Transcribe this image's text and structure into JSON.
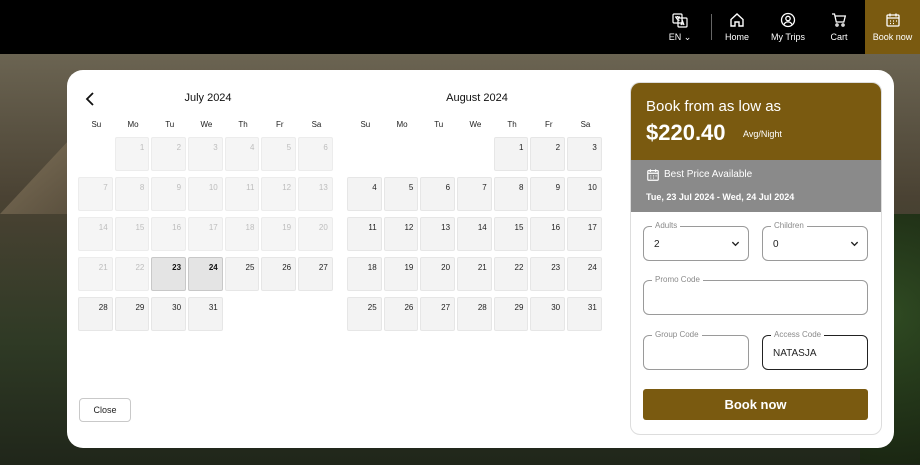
{
  "nav": {
    "language": "EN",
    "home": "Home",
    "trips": "My Trips",
    "cart": "Cart",
    "book": "Book now"
  },
  "calendar_left": {
    "title": "July 2024",
    "weekdays": [
      "Su",
      "Mo",
      "Tu",
      "We",
      "Th",
      "Fr",
      "Sa"
    ],
    "days": [
      "",
      "1",
      "2",
      "3",
      "4",
      "5",
      "6",
      "7",
      "8",
      "9",
      "10",
      "11",
      "12",
      "13",
      "14",
      "15",
      "16",
      "17",
      "18",
      "19",
      "20",
      "21",
      "22",
      "23",
      "24",
      "25",
      "26",
      "27",
      "28",
      "29",
      "30",
      "31"
    ]
  },
  "calendar_right": {
    "title": "August 2024",
    "weekdays": [
      "Su",
      "Mo",
      "Tu",
      "We",
      "Th",
      "Fr",
      "Sa"
    ],
    "days": [
      "",
      "",
      "",
      "",
      "1",
      "2",
      "3",
      "4",
      "5",
      "6",
      "7",
      "8",
      "9",
      "10",
      "11",
      "12",
      "13",
      "14",
      "15",
      "16",
      "17",
      "18",
      "19",
      "20",
      "21",
      "22",
      "23",
      "24",
      "25",
      "26",
      "27",
      "28",
      "29",
      "30",
      "31"
    ]
  },
  "close_label": "Close",
  "panel": {
    "from_label": "Book from as low as",
    "price": "$220.40",
    "per": "Avg/Night",
    "best_price": "Best Price Available",
    "dates": "Tue, 23 Jul 2024 - Wed, 24 Jul 2024",
    "adults_label": "Adults",
    "adults_value": "2",
    "children_label": "Children",
    "children_value": "0",
    "promo_label": "Promo Code",
    "promo_value": "",
    "group_label": "Group Code",
    "group_value": "",
    "access_label": "Access Code",
    "access_value": "NATASJA",
    "book_label": "Book now"
  },
  "colors": {
    "brand": "#7a5a10",
    "nav_bg": "#000000",
    "panel_sub": "#8a8a8a"
  }
}
